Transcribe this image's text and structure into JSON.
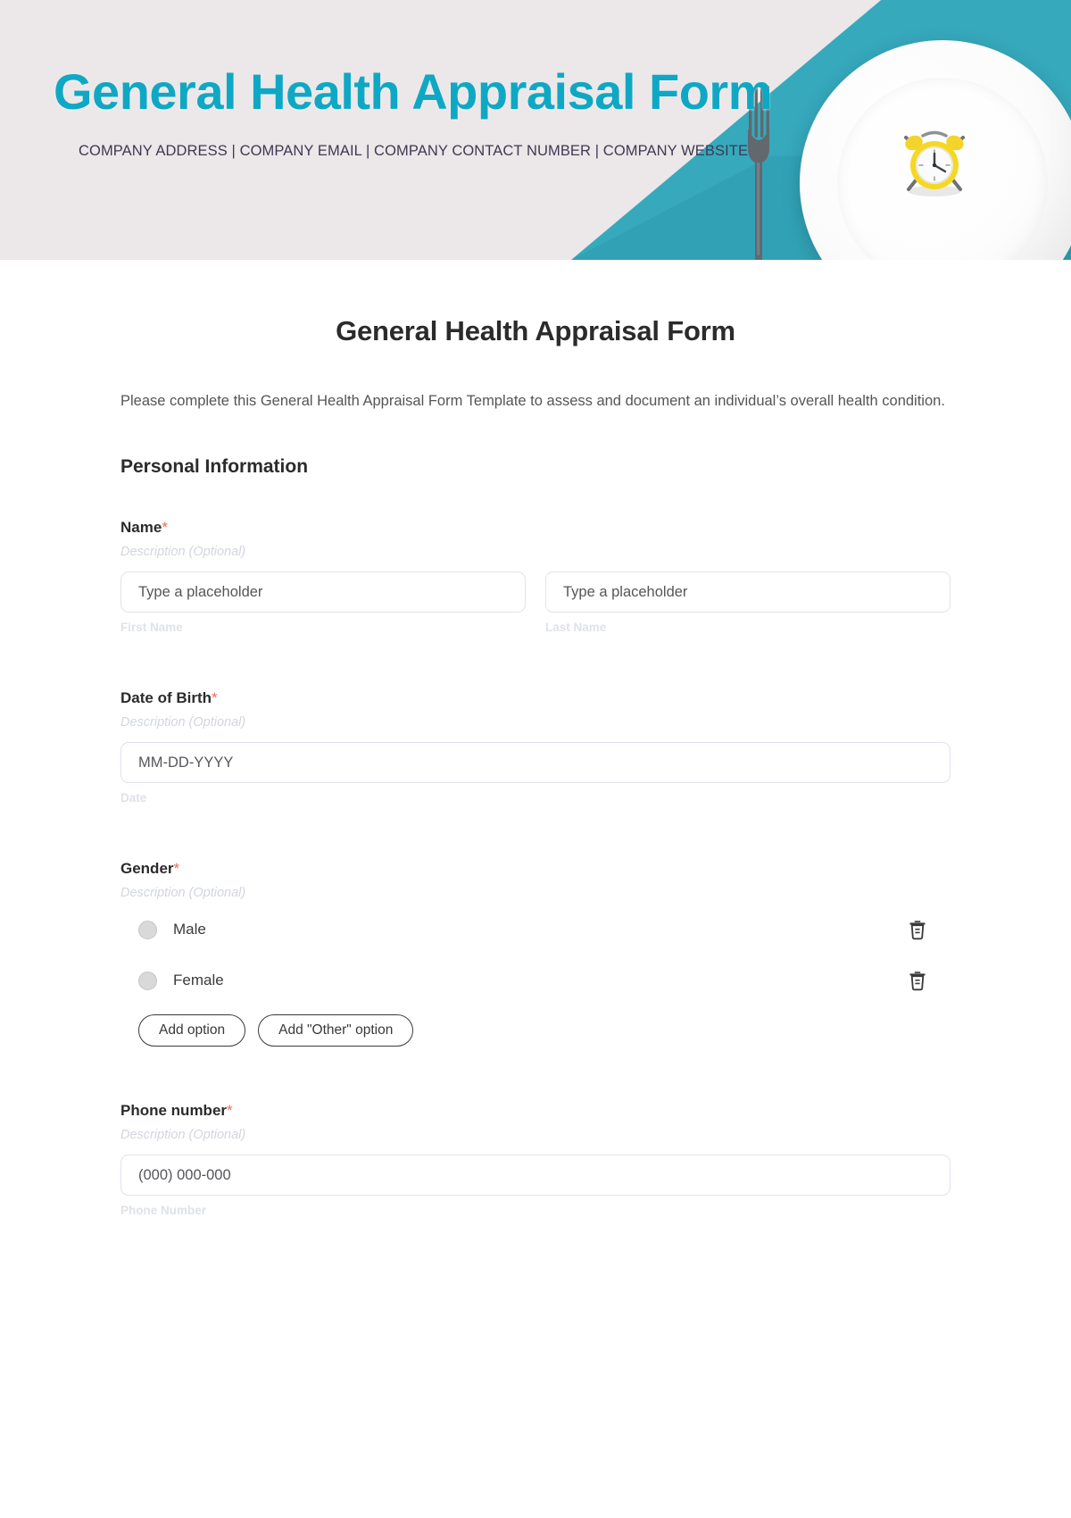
{
  "banner": {
    "title": "General Health Appraisal Form",
    "subtitle": "COMPANY ADDRESS | COMPANY EMAIL | COMPANY CONTACT NUMBER | COMPANY WEBSITE",
    "title_color": "#0fa8c4",
    "background_color": "#ece7e8",
    "accent_color": "#36a9bd",
    "photo_items": [
      "plate",
      "fork",
      "alarm-clock"
    ]
  },
  "form": {
    "title": "General Health Appraisal Form",
    "description": "Please complete this General Health Appraisal Form Template to assess and document an individual’s overall health condition.",
    "section_heading": "Personal Information",
    "required_marker": "*",
    "required_color": "#f4684f",
    "fields": [
      {
        "label": "Name",
        "required": true,
        "description": "Description (Optional)",
        "inputs": [
          {
            "placeholder": "Type a placeholder",
            "sub_label": "First Name"
          },
          {
            "placeholder": "Type a placeholder",
            "sub_label": "Last Name"
          }
        ]
      },
      {
        "label": "Date of Birth",
        "required": true,
        "description": "Description (Optional)",
        "inputs": [
          {
            "placeholder": "MM-DD-YYYY",
            "sub_label": "Date"
          }
        ]
      },
      {
        "label": "Gender",
        "required": true,
        "description": "Description (Optional)",
        "options": [
          "Male",
          "Female"
        ],
        "add_option_label": "Add option",
        "add_other_label": "Add \"Other\" option"
      },
      {
        "label": "Phone number",
        "required": true,
        "description": "Description (Optional)",
        "inputs": [
          {
            "placeholder": "(000) 000-000",
            "sub_label": "Phone Number"
          }
        ]
      }
    ]
  }
}
